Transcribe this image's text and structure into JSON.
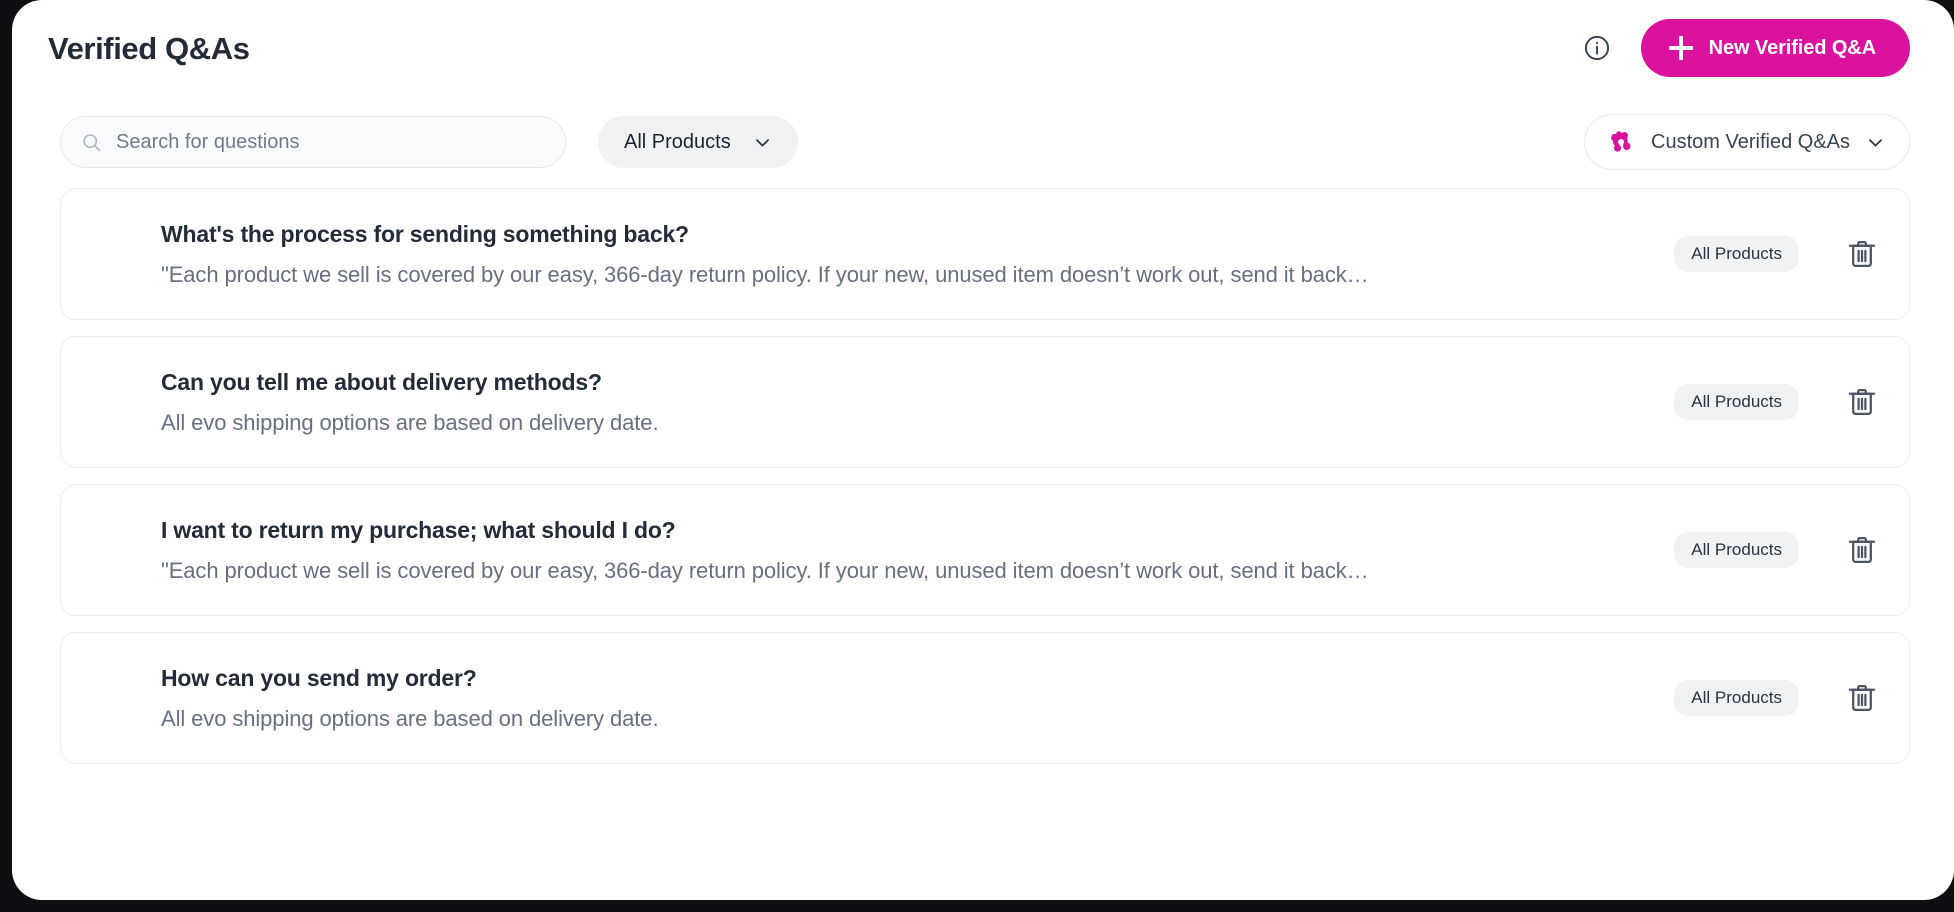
{
  "header": {
    "title": "Verified Q&As",
    "info_icon": "info-circle-icon",
    "new_button_label": "New Verified Q&A",
    "new_button_icon": "plus-icon",
    "accent_color": "#DB129E"
  },
  "toolbar": {
    "search": {
      "placeholder": "Search for questions",
      "value": "",
      "icon": "search-icon"
    },
    "products_filter": {
      "label": "All Products",
      "icon": "chevron-down-icon"
    },
    "source_filter": {
      "label": "Custom Verified Q&As",
      "brand_icon": "brand-clover-icon",
      "icon": "chevron-down-icon"
    }
  },
  "list": {
    "badge_label": "All Products",
    "delete_icon": "trash-icon",
    "items": [
      {
        "question": "What's the process for sending something back?",
        "answer": "\"Each product we sell is covered by our easy, 366-day return policy. If your new, unused item doesn’t work out, send it back…",
        "badge": "All Products"
      },
      {
        "question": "Can you tell me about delivery methods?",
        "answer": "All evo shipping options are based on delivery date.",
        "badge": "All Products"
      },
      {
        "question": "I want to return my purchase; what should I do?",
        "answer": "\"Each product we sell is covered by our easy, 366-day return policy. If your new, unused item doesn’t work out, send it back…",
        "badge": "All Products"
      },
      {
        "question": "How can you send my order?",
        "answer": "All evo shipping options are based on delivery date.",
        "badge": "All Products"
      }
    ]
  }
}
